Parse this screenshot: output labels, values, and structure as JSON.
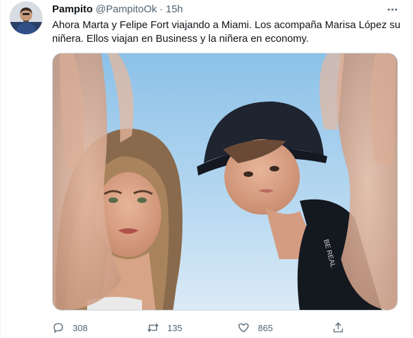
{
  "tweet": {
    "display_name": "Pampito",
    "handle": "@PampitoOk",
    "separator": "·",
    "time": "15h",
    "text": "Ahora Marta y Felipe Fort viajando a Miami. Los acompaña Marisa López su niñera. Ellos viajan en Business y la niñera en economy."
  },
  "media": {
    "description_icon": "photo"
  },
  "actions": {
    "reply_icon": "reply-icon",
    "reply_count": "308",
    "retweet_icon": "retweet-icon",
    "retweet_count": "135",
    "like_icon": "heart-icon",
    "like_count": "865",
    "share_icon": "share-icon"
  },
  "colors": {
    "text_primary": "#0f1419",
    "text_secondary": "#536471",
    "border": "#cfd9de",
    "sky": "#a9d0ee"
  }
}
